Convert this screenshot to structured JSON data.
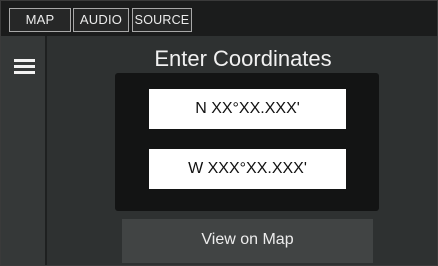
{
  "topbar": {
    "tabs": [
      {
        "label": "MAP"
      },
      {
        "label": "AUDIO"
      },
      {
        "label": "SOURCE"
      }
    ]
  },
  "sidebar": {
    "menu_icon": "hamburger-menu-icon"
  },
  "main": {
    "title": "Enter Coordinates",
    "latitude_value": "N XX°XX.XXX'",
    "longitude_value": "W XXX°XX.XXX'",
    "view_button_label": "View on Map"
  },
  "colors": {
    "background": "#2e3131",
    "topbar": "#1b1c1c",
    "panel": "#131414",
    "field": "#ffffff",
    "button": "#414444",
    "text": "#f1f1f1"
  }
}
